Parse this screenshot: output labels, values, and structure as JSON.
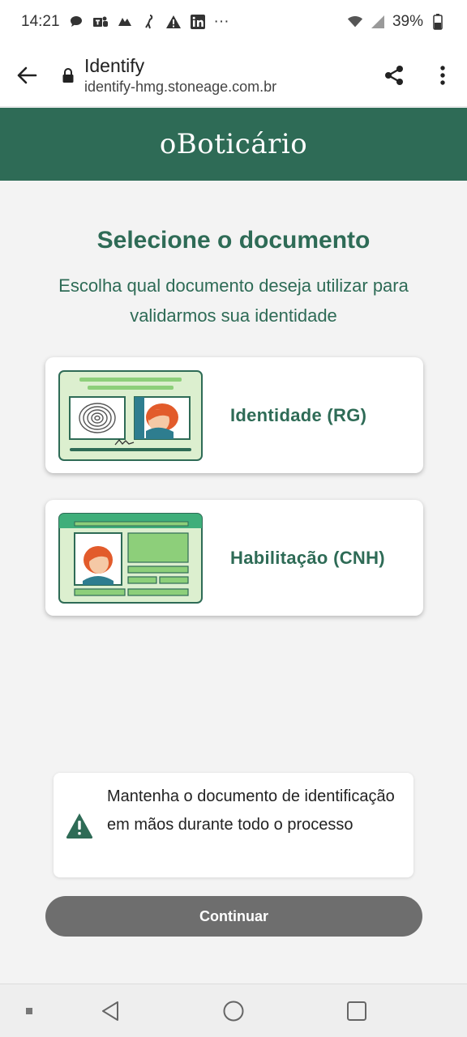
{
  "status_bar": {
    "time": "14:21",
    "battery": "39%",
    "more_indicator": "···",
    "notification_icons": [
      "chat-icon",
      "teams-icon",
      "stoneage-icon",
      "bird-icon",
      "alert-icon",
      "linkedin-icon"
    ]
  },
  "browser": {
    "title": "Identify",
    "url": "identify-hmg.stoneage.com.br"
  },
  "brand": {
    "logo_text": "oBoticário",
    "color": "#2e6b56"
  },
  "main": {
    "title": "Selecione o documento",
    "subtitle": "Escolha qual documento deseja utilizar para validarmos sua identidade",
    "options": [
      {
        "label": "Identidade (RG)",
        "icon": "rg-document-illustration"
      },
      {
        "label": "Habilitação (CNH)",
        "icon": "cnh-document-illustration"
      }
    ]
  },
  "notice": {
    "text": "Mantenha o documento de identificação em mãos durante todo o processo",
    "icon": "warning-icon"
  },
  "actions": {
    "continue_label": "Continuar"
  },
  "colors": {
    "accent": "#2e6b56",
    "button_disabled": "#6e6e6e",
    "illustration_light": "#dcefcf",
    "illustration_mid": "#8dcf7a"
  }
}
